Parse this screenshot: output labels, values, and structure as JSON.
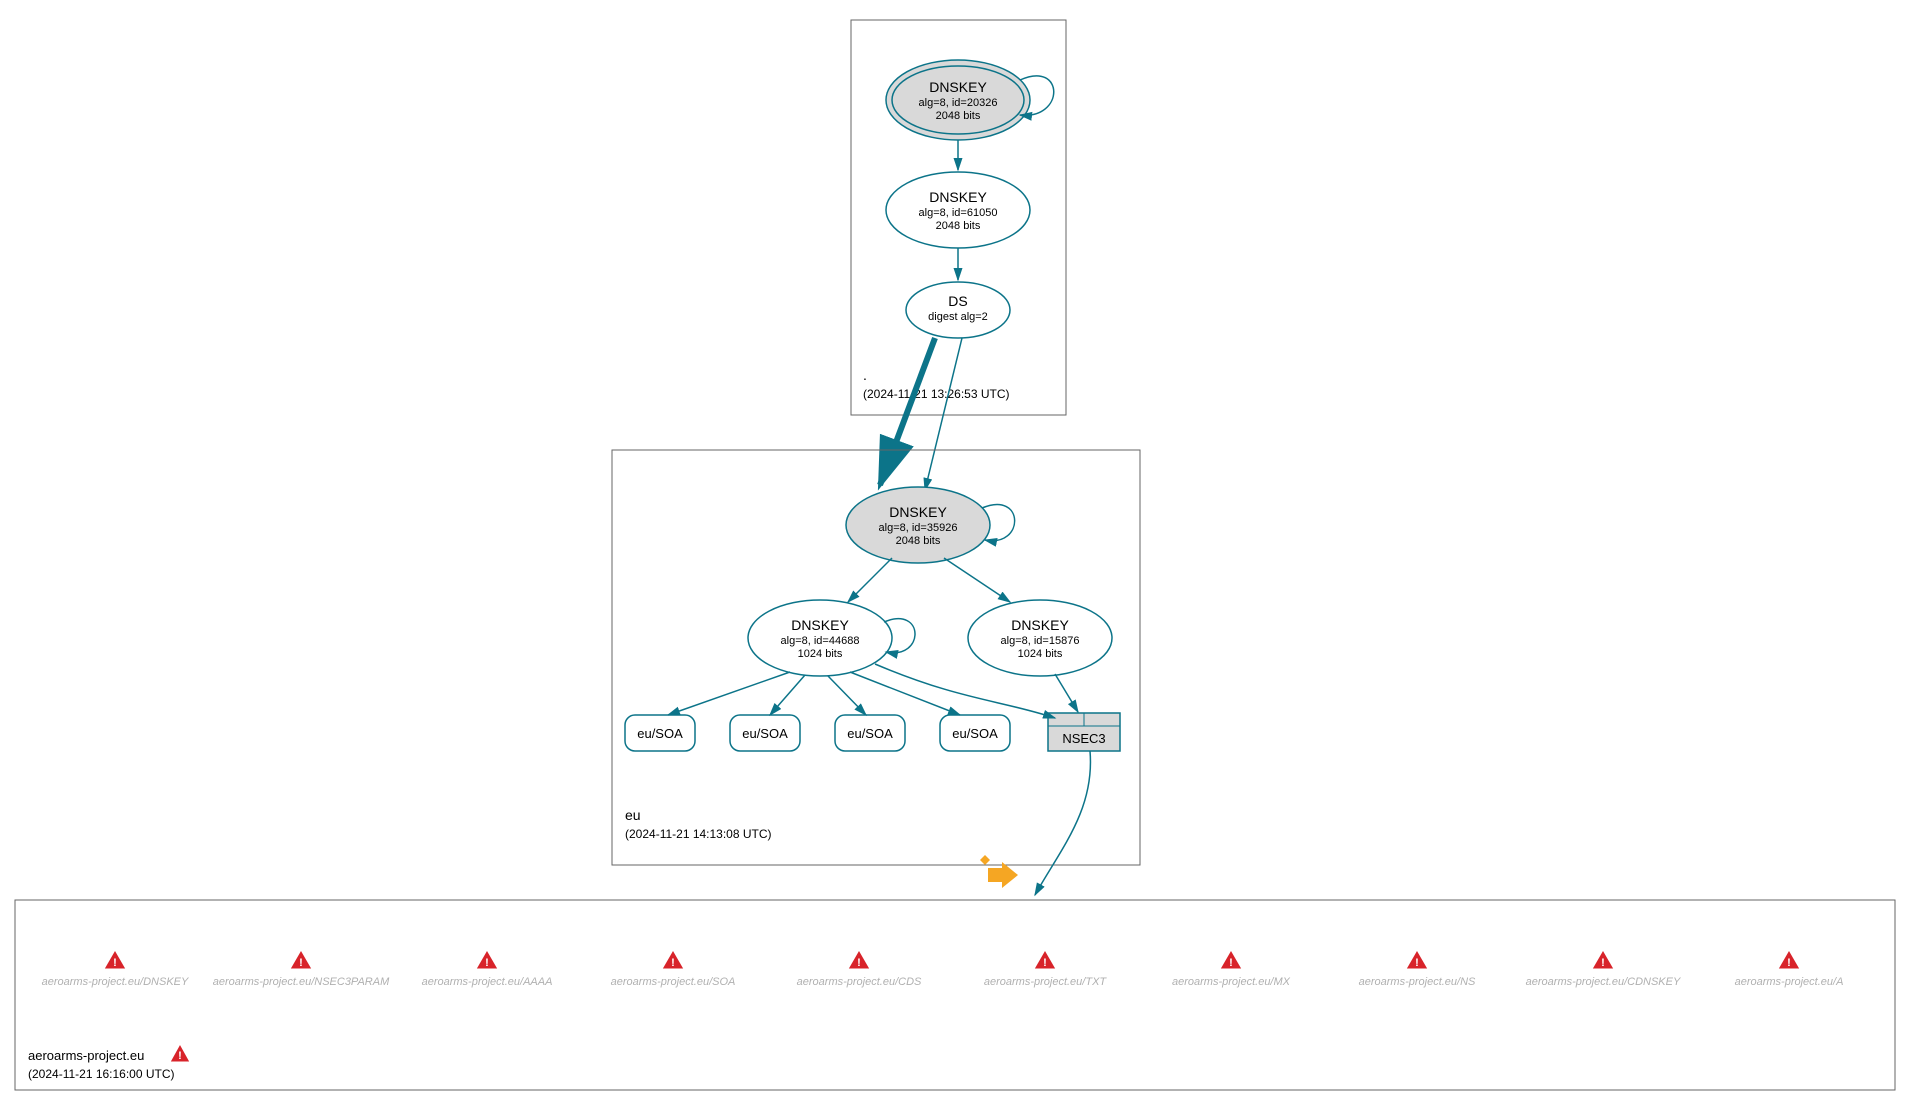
{
  "root_zone": {
    "label": ".",
    "timestamp": "(2024-11-21 13:26:53 UTC)",
    "dnskey_ksk": {
      "title": "DNSKEY",
      "line1": "alg=8, id=20326",
      "line2": "2048 bits"
    },
    "dnskey_zsk": {
      "title": "DNSKEY",
      "line1": "alg=8, id=61050",
      "line2": "2048 bits"
    },
    "ds": {
      "title": "DS",
      "line1": "digest alg=2"
    }
  },
  "eu_zone": {
    "label": "eu",
    "timestamp": "(2024-11-21 14:13:08 UTC)",
    "dnskey_ksk": {
      "title": "DNSKEY",
      "line1": "alg=8, id=35926",
      "line2": "2048 bits"
    },
    "dnskey_zsk1": {
      "title": "DNSKEY",
      "line1": "alg=8, id=44688",
      "line2": "1024 bits"
    },
    "dnskey_zsk2": {
      "title": "DNSKEY",
      "line1": "alg=8, id=15876",
      "line2": "1024 bits"
    },
    "soa": "eu/SOA",
    "nsec3": "NSEC3"
  },
  "target_zone": {
    "label": "aeroarms-project.eu",
    "timestamp": "(2024-11-21 16:16:00 UTC)",
    "errors": [
      "aeroarms-project.eu/DNSKEY",
      "aeroarms-project.eu/NSEC3PARAM",
      "aeroarms-project.eu/AAAA",
      "aeroarms-project.eu/SOA",
      "aeroarms-project.eu/CDS",
      "aeroarms-project.eu/TXT",
      "aeroarms-project.eu/MX",
      "aeroarms-project.eu/NS",
      "aeroarms-project.eu/CDNSKEY",
      "aeroarms-project.eu/A"
    ]
  }
}
